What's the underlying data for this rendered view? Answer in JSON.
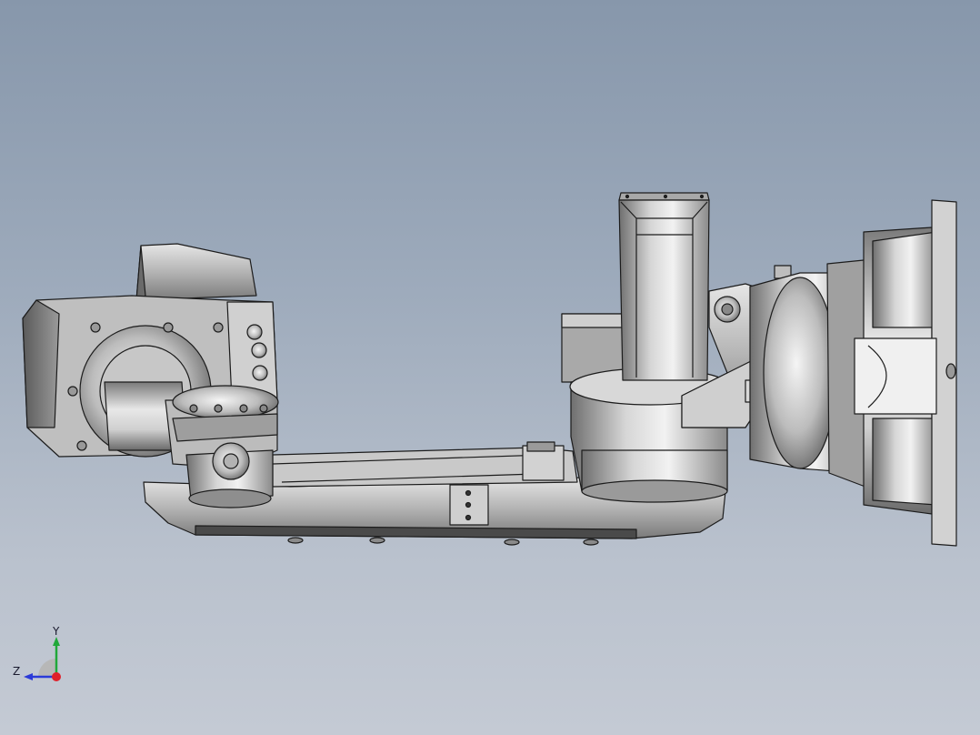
{
  "viewport": {
    "background_top": "#8797ab",
    "background_bottom": "#c4cad4",
    "model_shade": "#bdbdbd",
    "edge_color": "#1c1c1c"
  },
  "triad": {
    "y_label": "Y",
    "z_label": "Z",
    "x_dot_color": "#e0202a",
    "y_axis_color": "#21a83a",
    "z_axis_color": "#2a3ad8"
  }
}
